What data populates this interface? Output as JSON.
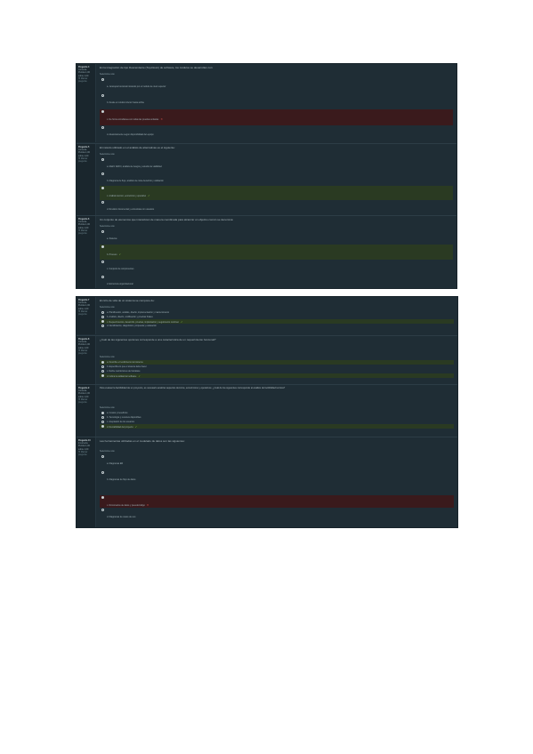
{
  "q_common": {
    "of_label": "Puntúa 1,00 sobre 1,00",
    "flag_label": "Marcar pregunta",
    "select_label": "Seleccione una:"
  },
  "shot1": {
    "q1": {
      "num": "Pregunta 4",
      "state": "Correcta",
      "text": "En la integración de tipo Descendente (Top-Down) de software, los módulos se desarrollan con:",
      "options": [
        "a. Jerarquía funcional iniciando por el módulo de nivel superior",
        "b. Desde el módulo inferior hacia arriba",
        "c. De forma simultánea con todas las pruebas unitarias",
        "d. Aleatoriamente según disponibilidad del equipo"
      ]
    },
    "q2": {
      "num": "Pregunta 5",
      "state": "Correcta",
      "text": "El método utilizado en el análisis de alternativas es el siguiente:",
      "options": [
        "a. Matriz DAFO, análisis de riesgos y estudio de viabilidad",
        "b. Diagrama de flujo, análisis de coste-beneficio y validación",
        "c. Análisis técnico, económico y operativo",
        "d. Revisión documental y entrevistas con usuarios"
      ]
    },
    "q3": {
      "num": "Pregunta 6",
      "state": "Correcta",
      "text": "Un conjunto de elementos que interactúan de manera coordinada para alcanzar un objetivo común se denomina:",
      "options": [
        "a. Sistema",
        "b. Proceso",
        "c. Conjunto de componentes",
        "d. Estructura organizacional"
      ]
    }
  },
  "shot2": {
    "q1": {
      "num": "Pregunta 7",
      "state": "Correcta",
      "text": "El ciclo de vida de un sistema se compone de:",
      "options": [
        "a. Planificación, análisis, diseño, implementación y mantenimiento",
        "b. Análisis, diseño, codificación y pruebas finales",
        "c. Requerimientos, desarrollo, pruebas, implantación y seguimiento continuo",
        "d. Identificación, diagnóstico, propuesta y evaluación"
      ]
    },
    "q2": {
      "num": "Pregunta 8",
      "state": "Correcta",
      "text": "¿Cuál de las siguientes opciones corresponde a una característica de un requerimiento funcional?",
      "options": [
        "a. Describe el rendimiento del sistema",
        "b. Especifica lo que el sistema debe hacer",
        "c. Define restricciones de hardware",
        "d. Indica la calidad del software"
      ]
    },
    "q3": {
      "num": "Pregunta 9",
      "state": "Correcta",
      "text": "Para evaluar la factibilidad de un proyecto, es necesario analizar aspectos técnicos, económicos y operativos. ¿Cuál de los siguientes corresponde al análisis de factibilidad técnica?",
      "options": [
        "a. Costos y beneficios",
        "b. Tecnología y recursos disponibles",
        "c. Aceptación de los usuarios",
        "d. Rentabilidad del proyecto"
      ]
    },
    "q4": {
      "num": "Pregunta 10",
      "state": "Incorrecta",
      "text": "Las herramientas utilizadas en el modelado de datos son las siguientes:",
      "options": [
        "a. Diagramas ER",
        "b. Diagramas de flujo de datos",
        "c. Diccionarios de datos y pseudocódigo",
        "d. Diagramas de casos de uso"
      ]
    }
  }
}
